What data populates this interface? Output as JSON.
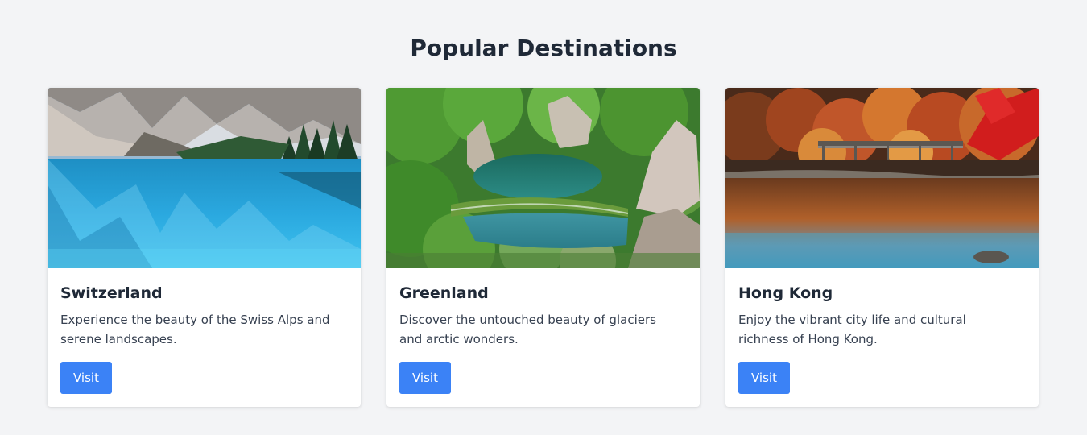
{
  "page": {
    "title": "Popular Destinations"
  },
  "colors": {
    "background": "#f3f4f6",
    "card": "#ffffff",
    "button": "#3b82f6",
    "title_text": "#1f2937"
  },
  "destinations": [
    {
      "name": "Switzerland",
      "description": "Experience the beauty of the Swiss Alps and serene landscapes.",
      "button_label": "Visit",
      "image": "mountain-lake-photo"
    },
    {
      "name": "Greenland",
      "description": "Discover the untouched beauty of glaciers and arctic wonders.",
      "button_label": "Visit",
      "image": "green-canyon-lakes-photo"
    },
    {
      "name": "Hong Kong",
      "description": "Enjoy the vibrant city life and cultural richness of Hong Kong.",
      "button_label": "Visit",
      "image": "autumn-river-bridge-photo"
    }
  ]
}
